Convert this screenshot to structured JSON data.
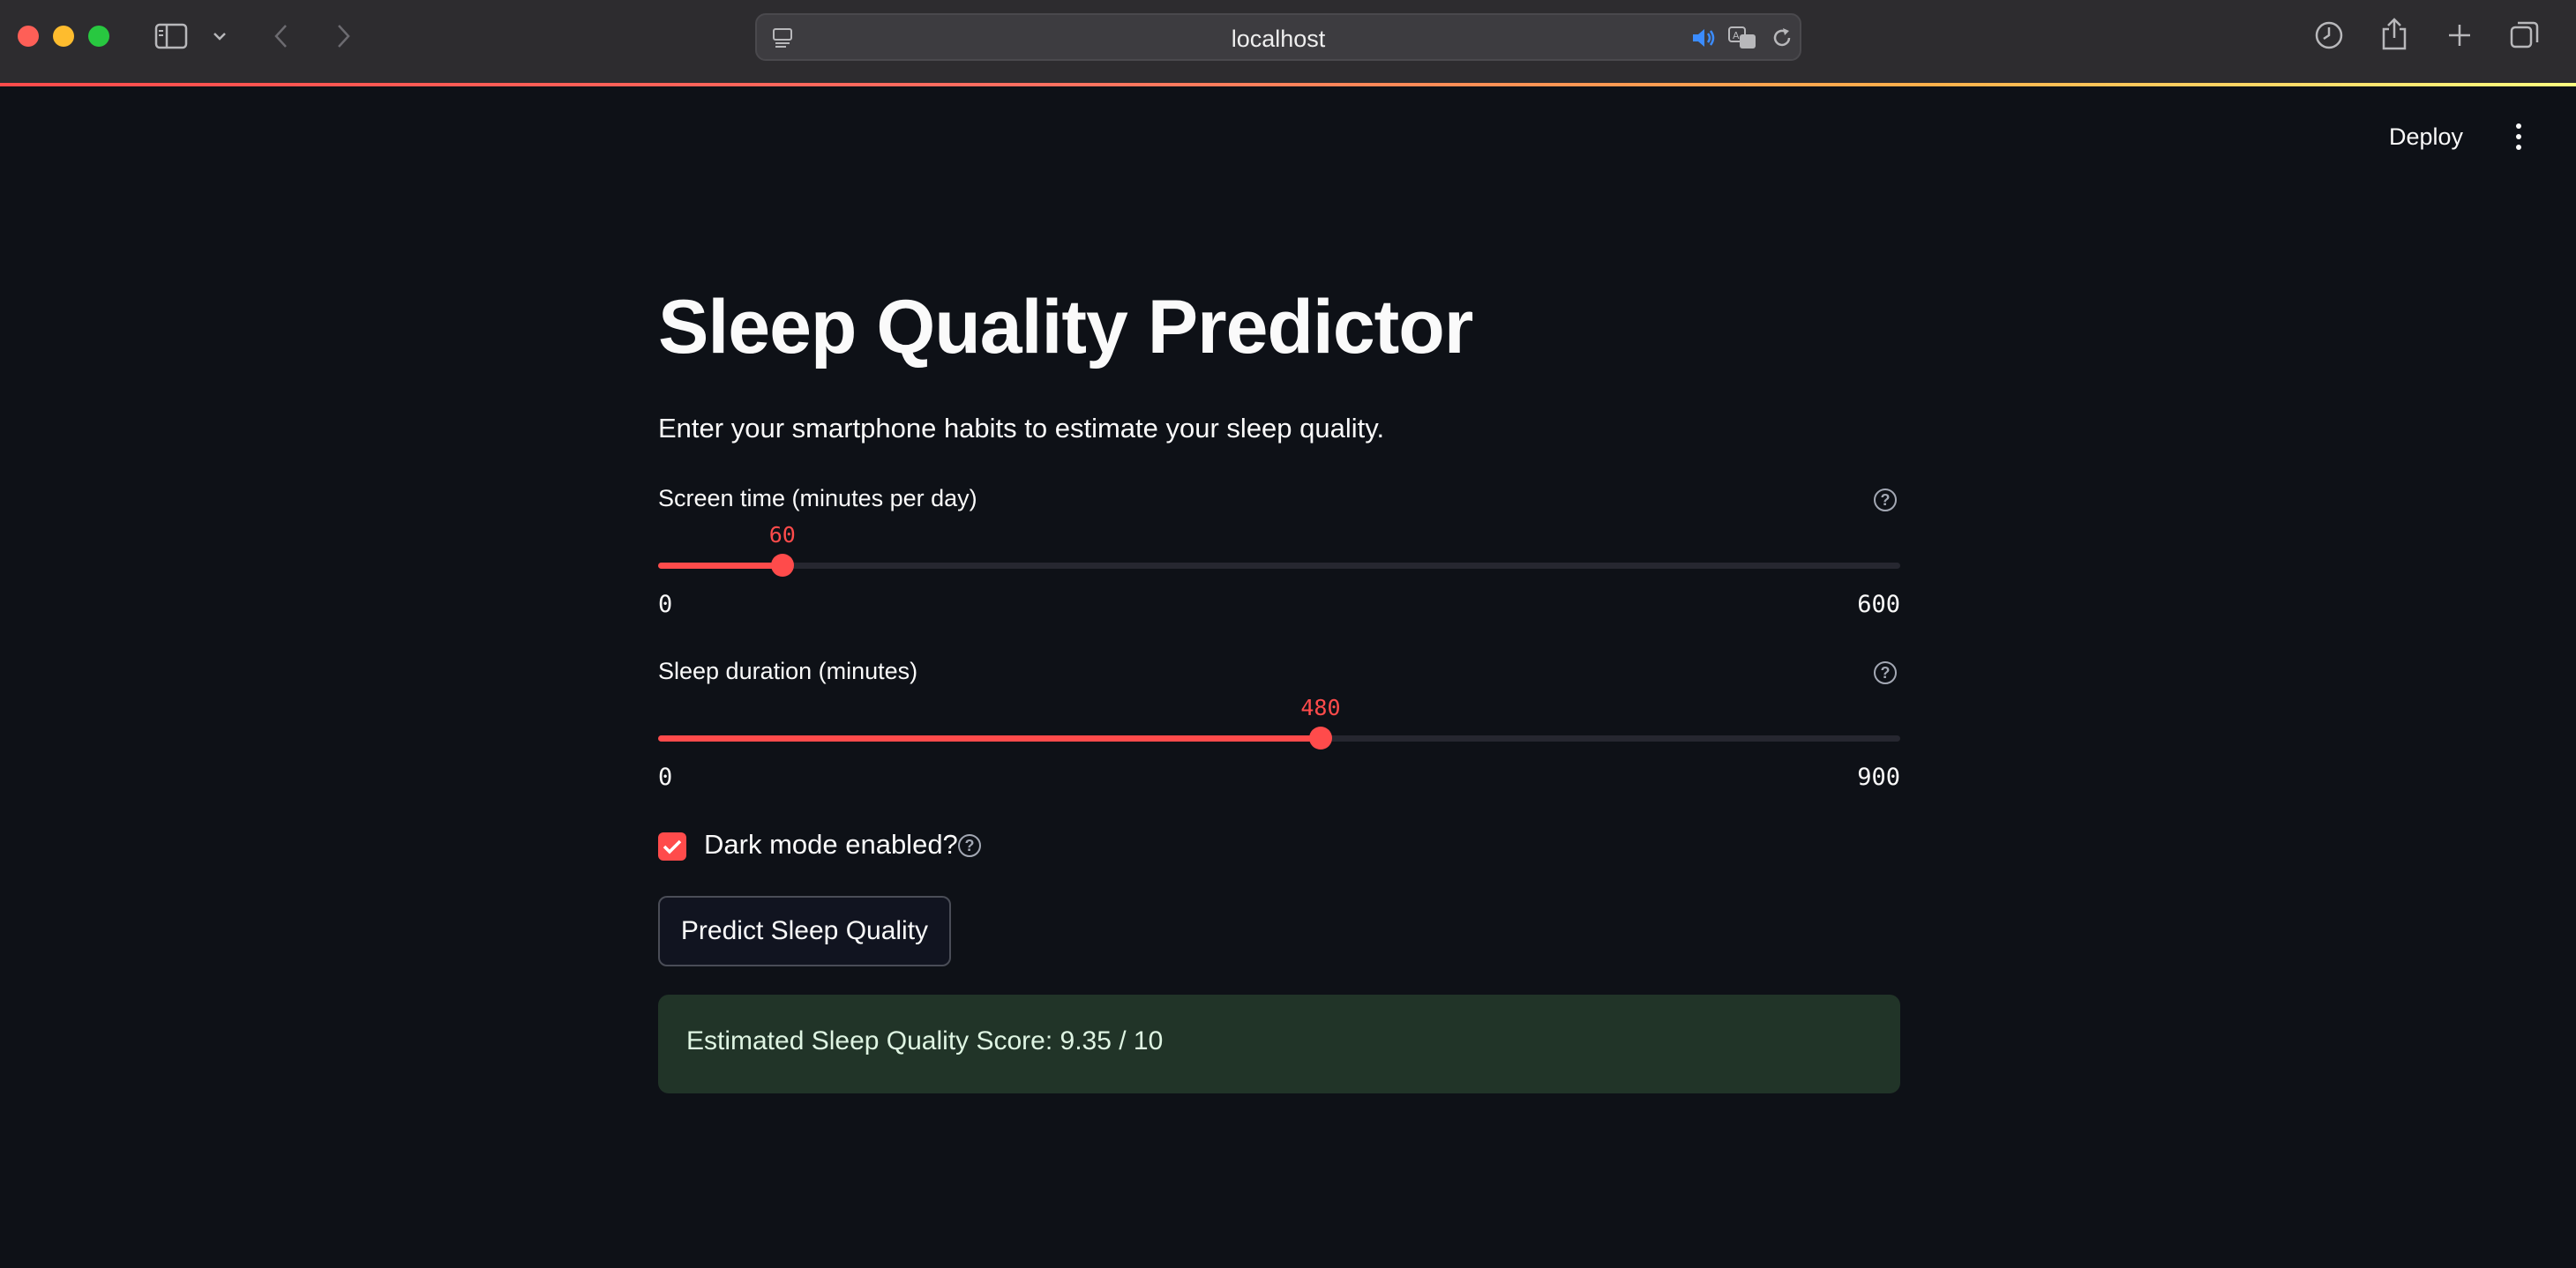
{
  "browser": {
    "url": "localhost"
  },
  "app_header": {
    "deploy_label": "Deploy"
  },
  "main": {
    "title": "Sleep Quality Predictor",
    "subtitle": "Enter your smartphone habits to estimate your sleep quality."
  },
  "screen_time": {
    "label": "Screen time (minutes per day)",
    "value": "60",
    "min": "0",
    "max": "600"
  },
  "sleep_duration": {
    "label": "Sleep duration (minutes)",
    "value": "480",
    "min": "0",
    "max": "900"
  },
  "dark_mode": {
    "label": "Dark mode enabled?",
    "checked": true
  },
  "predict_button": {
    "label": "Predict Sleep Quality"
  },
  "result": {
    "text": "Estimated Sleep Quality Score: 9.35 / 10"
  },
  "colors": {
    "accent": "#ff4b4b",
    "background": "#0e1117",
    "success_bg": "#213428"
  }
}
